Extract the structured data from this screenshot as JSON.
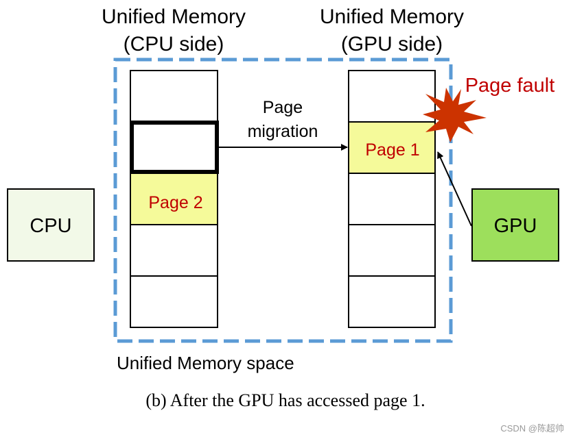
{
  "titles": {
    "cpu_side_line1": "Unified Memory",
    "cpu_side_line2": "(CPU side)",
    "gpu_side_line1": "Unified Memory",
    "gpu_side_line2": "(GPU side)"
  },
  "nodes": {
    "cpu": "CPU",
    "gpu": "GPU"
  },
  "pages": {
    "page1": "Page 1",
    "page2": "Page 2"
  },
  "labels": {
    "migration_line1": "Page",
    "migration_line2": "migration",
    "page_fault": "Page fault",
    "space": "Unified Memory space"
  },
  "caption": "(b) After the GPU has accessed page 1.",
  "watermark": "CSDN @陈超帅",
  "colors": {
    "dashed_border": "#5b9bd5",
    "page_fill": "#f5fa9a",
    "page_text": "#c00000",
    "cpu_fill": "#f2f9e8",
    "gpu_fill": "#9ddf5c",
    "fault_star": "#cc3300"
  }
}
